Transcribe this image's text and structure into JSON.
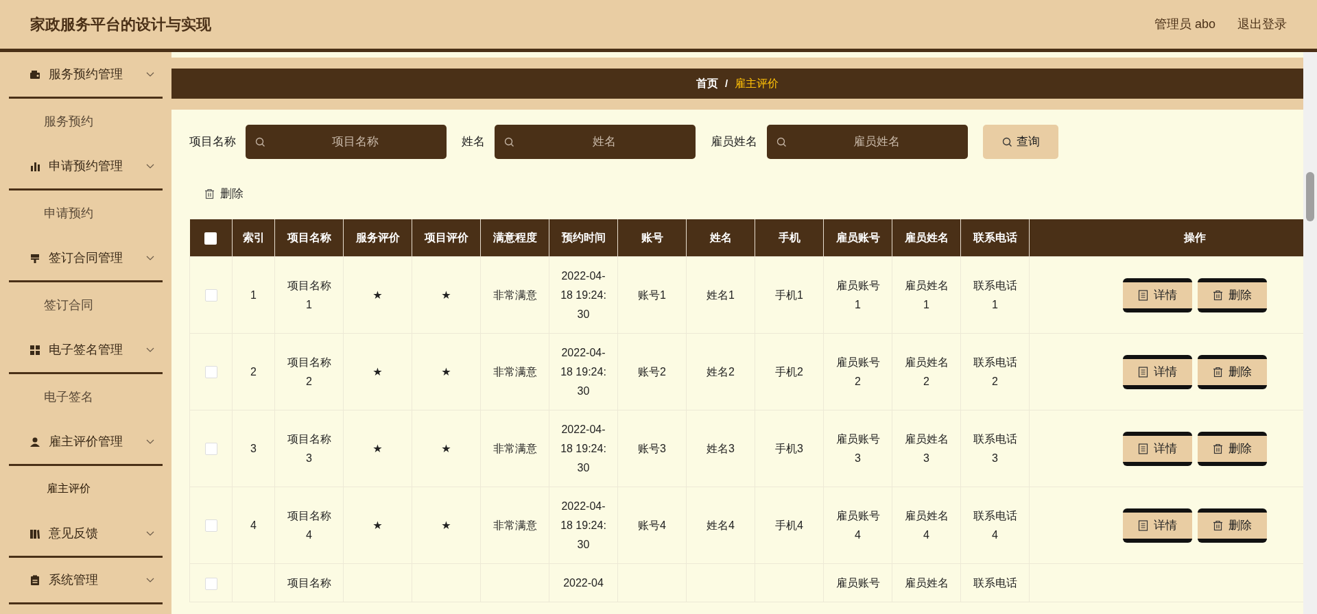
{
  "header": {
    "title": "家政服务平台的设计与实现",
    "user": "管理员 abo",
    "logout": "退出登录"
  },
  "sidebar": {
    "items": [
      {
        "label": "服务预约管理",
        "children": [
          {
            "label": "服务预约",
            "selected": false
          }
        ]
      },
      {
        "label": "申请预约管理",
        "children": [
          {
            "label": "申请预约",
            "selected": false
          }
        ]
      },
      {
        "label": "签订合同管理",
        "children": [
          {
            "label": "签订合同",
            "selected": false
          }
        ]
      },
      {
        "label": "电子签名管理",
        "children": [
          {
            "label": "电子签名",
            "selected": false
          }
        ]
      },
      {
        "label": "雇主评价管理",
        "children": [
          {
            "label": "雇主评价",
            "selected": true
          }
        ]
      },
      {
        "label": "意见反馈"
      },
      {
        "label": "系统管理"
      }
    ]
  },
  "breadcrumb": {
    "items": [
      "首页",
      "雇主评价"
    ],
    "separator": "/"
  },
  "search": {
    "fields": [
      {
        "label": "项目名称",
        "placeholder": "项目名称"
      },
      {
        "label": "姓名",
        "placeholder": "姓名"
      },
      {
        "label": "雇员姓名",
        "placeholder": "雇员姓名"
      }
    ],
    "button": "查询"
  },
  "toolbar": {
    "delete": "删除"
  },
  "table": {
    "columns": [
      "索引",
      "项目名称",
      "服务评价",
      "项目评价",
      "满意程度",
      "预约时间",
      "账号",
      "姓名",
      "手机",
      "雇员账号",
      "雇员姓名",
      "联系电话",
      "操作"
    ],
    "header_checked": false,
    "rows": [
      {
        "checked": false,
        "cells": [
          "1",
          "项目名称1",
          "★",
          "★",
          "非常满意",
          "2022-04-18 19:24:30",
          "账号1",
          "姓名1",
          "手机1",
          "雇员账号1",
          "雇员姓名1",
          "联系电话1"
        ],
        "actions": [
          "详情",
          "删除"
        ]
      },
      {
        "checked": false,
        "cells": [
          "2",
          "项目名称2",
          "★",
          "★",
          "非常满意",
          "2022-04-18 19:24:30",
          "账号2",
          "姓名2",
          "手机2",
          "雇员账号2",
          "雇员姓名2",
          "联系电话2"
        ],
        "actions": [
          "详情",
          "删除"
        ]
      },
      {
        "checked": false,
        "cells": [
          "3",
          "项目名称3",
          "★",
          "★",
          "非常满意",
          "2022-04-18 19:24:30",
          "账号3",
          "姓名3",
          "手机3",
          "雇员账号3",
          "雇员姓名3",
          "联系电话3"
        ],
        "actions": [
          "详情",
          "删除"
        ]
      },
      {
        "checked": false,
        "cells": [
          "4",
          "项目名称4",
          "★",
          "★",
          "非常满意",
          "2022-04-18 19:24:30",
          "账号4",
          "姓名4",
          "手机4",
          "雇员账号4",
          "雇员姓名4",
          "联系电话4"
        ],
        "actions": [
          "详情",
          "删除"
        ]
      },
      {
        "checked": false,
        "cells": [
          "",
          "项目名称",
          "",
          "",
          "",
          "2022-04",
          "",
          "",
          "",
          "雇员账号",
          "雇员姓名",
          "联系电话"
        ]
      }
    ]
  }
}
